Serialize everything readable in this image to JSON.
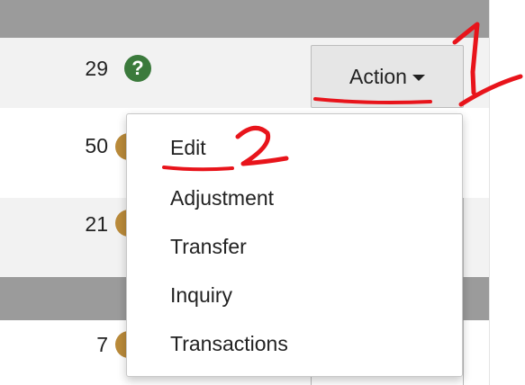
{
  "rows": [
    {
      "qty": "29"
    },
    {
      "qty": "50"
    },
    {
      "qty": "21"
    },
    {
      "qty": "7"
    }
  ],
  "help_icon_glyph": "?",
  "action_button": {
    "label": "Action"
  },
  "action_menu": {
    "items": [
      "Edit",
      "Adjustment",
      "Transfer",
      "Inquiry",
      "Transactions"
    ]
  },
  "annotations": {
    "step_1": "1",
    "step_2": "2",
    "color": "#e8141b"
  },
  "colors": {
    "header_bar": "#9b9b9b",
    "row_stripe": "#f2f2f2",
    "help_icon": "#3b7a3c",
    "button_bg": "#e6e6e6"
  }
}
